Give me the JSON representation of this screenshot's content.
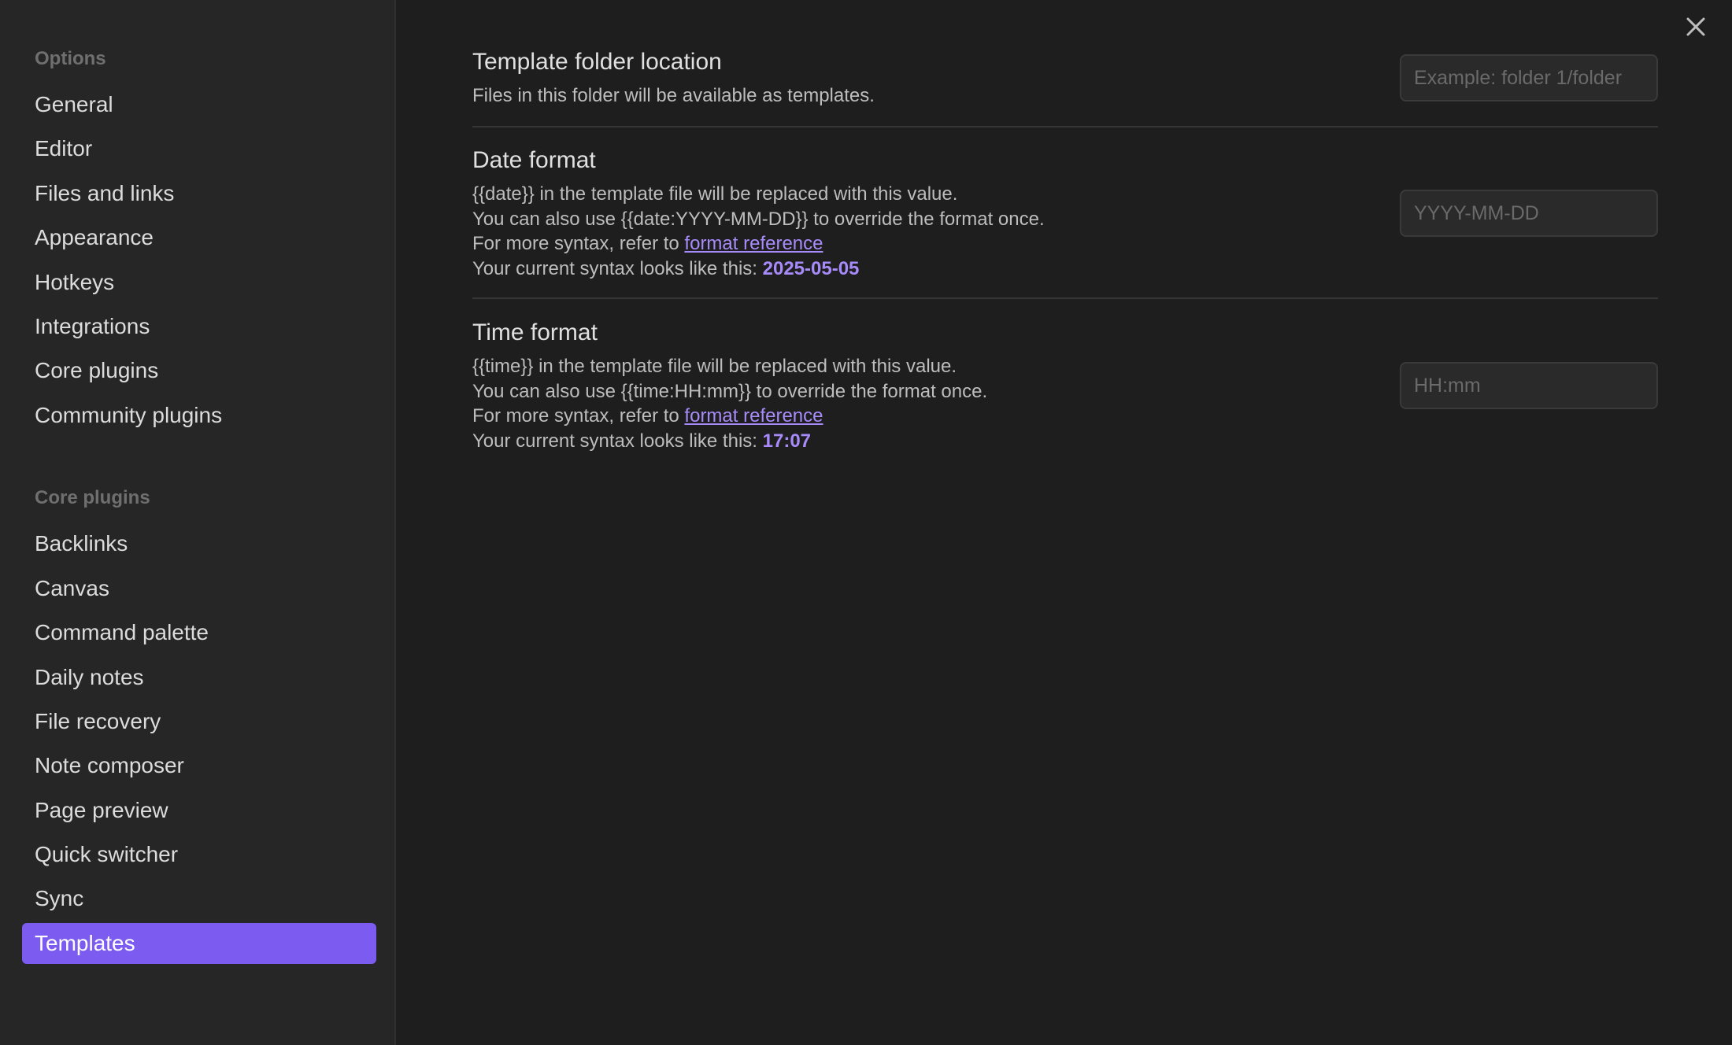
{
  "sidebar": {
    "options_heading": "Options",
    "options_items": [
      {
        "label": "General"
      },
      {
        "label": "Editor"
      },
      {
        "label": "Files and links"
      },
      {
        "label": "Appearance"
      },
      {
        "label": "Hotkeys"
      },
      {
        "label": "Integrations"
      },
      {
        "label": "Core plugins"
      },
      {
        "label": "Community plugins"
      }
    ],
    "core_heading": "Core plugins",
    "core_items": [
      {
        "label": "Backlinks"
      },
      {
        "label": "Canvas"
      },
      {
        "label": "Command palette"
      },
      {
        "label": "Daily notes"
      },
      {
        "label": "File recovery"
      },
      {
        "label": "Note composer"
      },
      {
        "label": "Page preview"
      },
      {
        "label": "Quick switcher"
      },
      {
        "label": "Sync"
      },
      {
        "label": "Templates",
        "active": true
      }
    ]
  },
  "close_icon": "close-icon",
  "settings": {
    "folder": {
      "title": "Template folder location",
      "desc": "Files in this folder will be available as templates.",
      "input_value": "",
      "placeholder": "Example: folder 1/folder"
    },
    "date": {
      "title": "Date format",
      "line1": "{{date}} in the template file will be replaced with this value.",
      "line2": "You can also use {{date:YYYY-MM-DD}} to override the format once.",
      "line3_prefix": "For more syntax, refer to ",
      "link": "format reference",
      "line4_prefix": "Your current syntax looks like this: ",
      "current": "2025-05-05",
      "input_value": "",
      "placeholder": "YYYY-MM-DD"
    },
    "time": {
      "title": "Time format",
      "line1": "{{time}} in the template file will be replaced with this value.",
      "line2": "You can also use {{time:HH:mm}} to override the format once.",
      "line3_prefix": "For more syntax, refer to ",
      "link": "format reference",
      "line4_prefix": "Your current syntax looks like this: ",
      "current": "17:07",
      "input_value": "",
      "placeholder": "HH:mm"
    }
  },
  "colors": {
    "accent": "#7c5cf0",
    "link": "#a88bfa",
    "background": "#1e1e1e",
    "sidebar_bg": "#262626"
  }
}
